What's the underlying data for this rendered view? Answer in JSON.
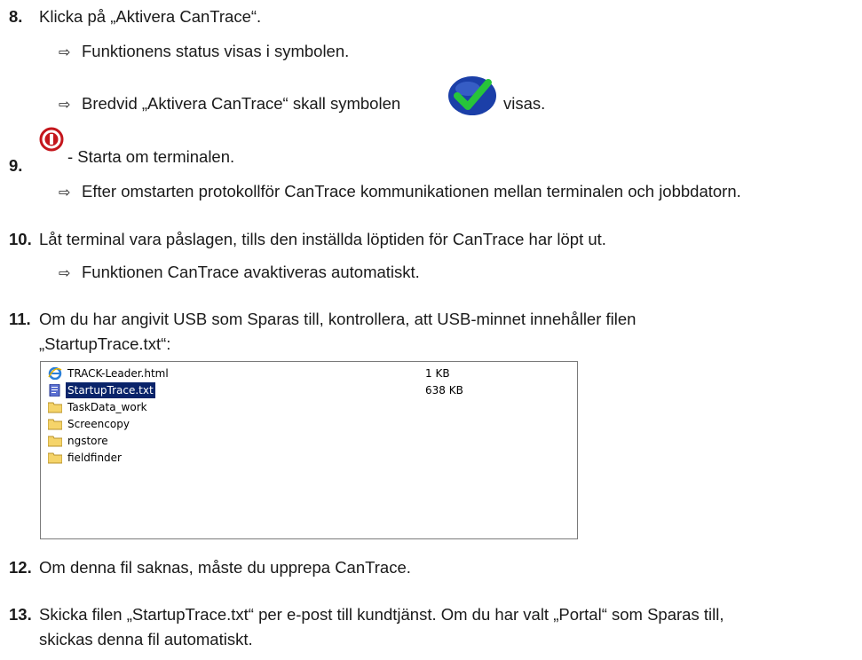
{
  "steps": [
    {
      "num": "8.",
      "text": "Klicka på „Aktivera CanTrace“."
    },
    {
      "num": "9.",
      "text": "- Starta om terminalen."
    },
    {
      "num": "10.",
      "text": "Låt terminal vara påslagen, tills den inställda löptiden för CanTrace har löpt ut."
    },
    {
      "num": "11.",
      "text_line1": "Om du har angivit USB som Sparas till, kontrollera, att USB-minnet innehåller filen",
      "text_line2": "„StartupTrace.txt“:"
    },
    {
      "num": "12.",
      "text": "Om denna fil saknas, måste du upprepa CanTrace."
    },
    {
      "num": "13.",
      "text_line1": "Skicka filen „StartupTrace.txt“ per e-post till kundtjänst. Om du har valt „Portal“ som Sparas till,",
      "text_line2": "skickas denna fil automatiskt."
    }
  ],
  "results": {
    "r8a": "Funktionens status visas i symbolen.",
    "r8b_before": "Bredvid „Aktivera CanTrace“ skall symbolen",
    "r8b_after": "visas.",
    "r9": "Efter omstarten protokollför CanTrace kommunikationen mellan terminalen och jobbdatorn.",
    "r10": "Funktionen CanTrace avaktiveras automatiskt."
  },
  "arrow_glyph": "⇨",
  "icons": {
    "check": "checkmark-icon",
    "power": "power-icon"
  },
  "colors": {
    "check_bg": "#1b3fa8",
    "check_mark": "#27c43a",
    "power": "#c4161c",
    "selection": "#0a246a"
  },
  "file_list": [
    {
      "name": "TRACK-Leader.html",
      "size": "1 KB",
      "icon": "ie-icon",
      "selected": false
    },
    {
      "name": "StartupTrace.txt",
      "size": "638 KB",
      "icon": "text-file-icon",
      "selected": true
    },
    {
      "name": "TaskData_work",
      "size": "",
      "icon": "folder-icon",
      "selected": false
    },
    {
      "name": "Screencopy",
      "size": "",
      "icon": "folder-icon",
      "selected": false
    },
    {
      "name": "ngstore",
      "size": "",
      "icon": "folder-icon",
      "selected": false
    },
    {
      "name": "fieldfinder",
      "size": "",
      "icon": "folder-icon",
      "selected": false
    }
  ]
}
